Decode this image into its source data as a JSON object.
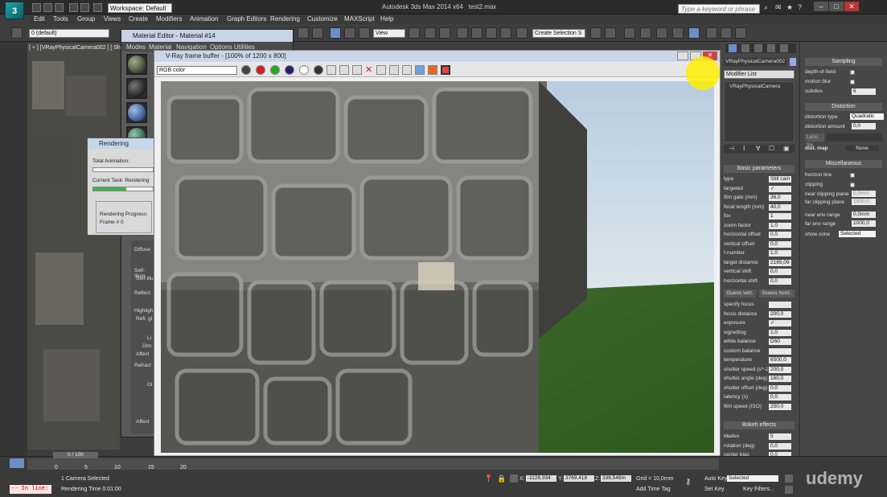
{
  "app": {
    "title": "Autodesk 3ds Max 2014 x64",
    "file": "test2.max",
    "workspace": "Workspace: Default",
    "help_search_placeholder": "Type a keyword or phrase"
  },
  "menus": [
    "Edit",
    "Tools",
    "Group",
    "Views",
    "Create",
    "Modifiers",
    "Animation",
    "Graph Editors",
    "Rendering",
    "Customize",
    "MAXScript",
    "Help"
  ],
  "toolbar": {
    "layer": "0 (default)",
    "view_dropdown": "View",
    "selection_set": "Create Selection S"
  },
  "viewport": {
    "label": "[ + ] [VRayPhysicalCamera002 ] [ Shaded ]"
  },
  "material_editor": {
    "title": "Material Editor - Material #14",
    "menu": [
      "Modes",
      "Material",
      "Navigation",
      "Options",
      "Utilities"
    ],
    "params": [
      "Diffuse",
      "Self-Illum",
      "Self-Illu",
      "Reflect",
      "Highlight",
      "Refl. gl",
      "Li",
      "Dim",
      "Affect",
      "Refract",
      "Gl",
      "Affect"
    ]
  },
  "rendering_dialog": {
    "title": "Rendering",
    "total_animation": "Total Animation:",
    "current_task": "Current Task: Rendering",
    "rendering_progress": "Rendering Progress:",
    "frame": "Frame #  0",
    "total_progress": 0.0,
    "current_progress": 0.55
  },
  "vfb": {
    "title": "V-Ray frame buffer - [100% of 1200 x 800]",
    "channel": "RGB color"
  },
  "command_panel": {
    "object_name": "VRayPhysicalCamera002",
    "modifier_list": "Modifier List",
    "stack_item": "VRayPhysicalCamera",
    "basic_parameters": "Basic parameters",
    "rows": [
      {
        "label": "type",
        "value": "Still cam"
      },
      {
        "label": "targeted",
        "value": "✓"
      },
      {
        "label": "film gate (mm)",
        "value": "36,0"
      },
      {
        "label": "focal length (mm)",
        "value": "40,0"
      },
      {
        "label": "fov",
        "value": "1"
      },
      {
        "label": "zoom factor",
        "value": "1,0"
      },
      {
        "label": "horizontal offset",
        "value": "0,0"
      },
      {
        "label": "vertical offset",
        "value": "0,0"
      },
      {
        "label": "f-number",
        "value": "1,0"
      },
      {
        "label": "target distance",
        "value": "2185,09"
      },
      {
        "label": "vertical shift",
        "value": "0,0"
      },
      {
        "label": "horizontal shift",
        "value": "0,0"
      }
    ],
    "guess_vert": "Guess vert.",
    "guess_horiz": "Guess horiz.",
    "rows2": [
      {
        "label": "specify focus",
        "value": ""
      },
      {
        "label": "focus distance",
        "value": "200,0"
      },
      {
        "label": "exposure",
        "value": "✓"
      },
      {
        "label": "vignetting",
        "value": "1,0"
      },
      {
        "label": "white balance",
        "value": "D50"
      },
      {
        "label": "custom balance",
        "value": ""
      },
      {
        "label": "temperature",
        "value": "6500,0"
      },
      {
        "label": "shutter speed (s^-1)",
        "value": "200,0"
      },
      {
        "label": "shutter angle (deg)",
        "value": "180,0"
      },
      {
        "label": "shutter offset (deg)",
        "value": "0,0"
      },
      {
        "label": "latency (s)",
        "value": "0,0"
      },
      {
        "label": "film speed (ISO)",
        "value": "250,0"
      }
    ],
    "bokeh_effects": "Bokeh effects",
    "rows3": [
      {
        "label": "blades",
        "value": "5"
      },
      {
        "label": "rotation (deg)",
        "value": "0,0"
      },
      {
        "label": "center bias",
        "value": "0,0"
      },
      {
        "label": "anisotropy",
        "value": "0,0"
      }
    ]
  },
  "vray_params": {
    "sampling": "Sampling",
    "depth_of_field": "depth-of-field",
    "motion_blur": "motion blur",
    "subdivs": "subdivs",
    "subdivs_value": "6",
    "distortion": "Distortion",
    "distortion_type": "distortion type",
    "distortion_type_value": "Quadratic",
    "distortion_amount": "distortion amount",
    "distortion_amount_value": "0,0",
    "lens_file": "Lens file",
    "dist_map": "dist. map",
    "dist_map_value": "None",
    "miscellaneous": "Miscellaneous",
    "horizon_line": "horizon line",
    "clipping": "clipping",
    "near_clipping": "near clipping plane",
    "near_clipping_value": "0,0mm",
    "far_clipping": "far clipping plane",
    "far_clipping_value": "1000,0",
    "near_env": "near env range",
    "near_env_value": "0,0mm",
    "far_env": "far env range",
    "far_env_value": "1000,0",
    "show_cone": "show cone",
    "show_cone_value": "Selected"
  },
  "status": {
    "timeline": "0 / 100",
    "selected": "1 Camera Selected",
    "rendering_time": "Rendering Time  0:01:00",
    "maxscript": "-- In line:",
    "x": "-1128,934",
    "y": "3769,418",
    "z": "338,548m",
    "grid": "Grid = 10,0mm",
    "add_time_tag": "Add Time Tag",
    "auto_key": "Auto Key",
    "set_key": "Set Key",
    "selected_dd": "Selected",
    "key_filters": "Key Filters...",
    "ticks": [
      "0",
      "5",
      "10",
      "15",
      "20"
    ]
  },
  "watermark": "udemy",
  "colors": {
    "accent": "#6b8fc5",
    "title_bar": "#c9d7e9"
  }
}
